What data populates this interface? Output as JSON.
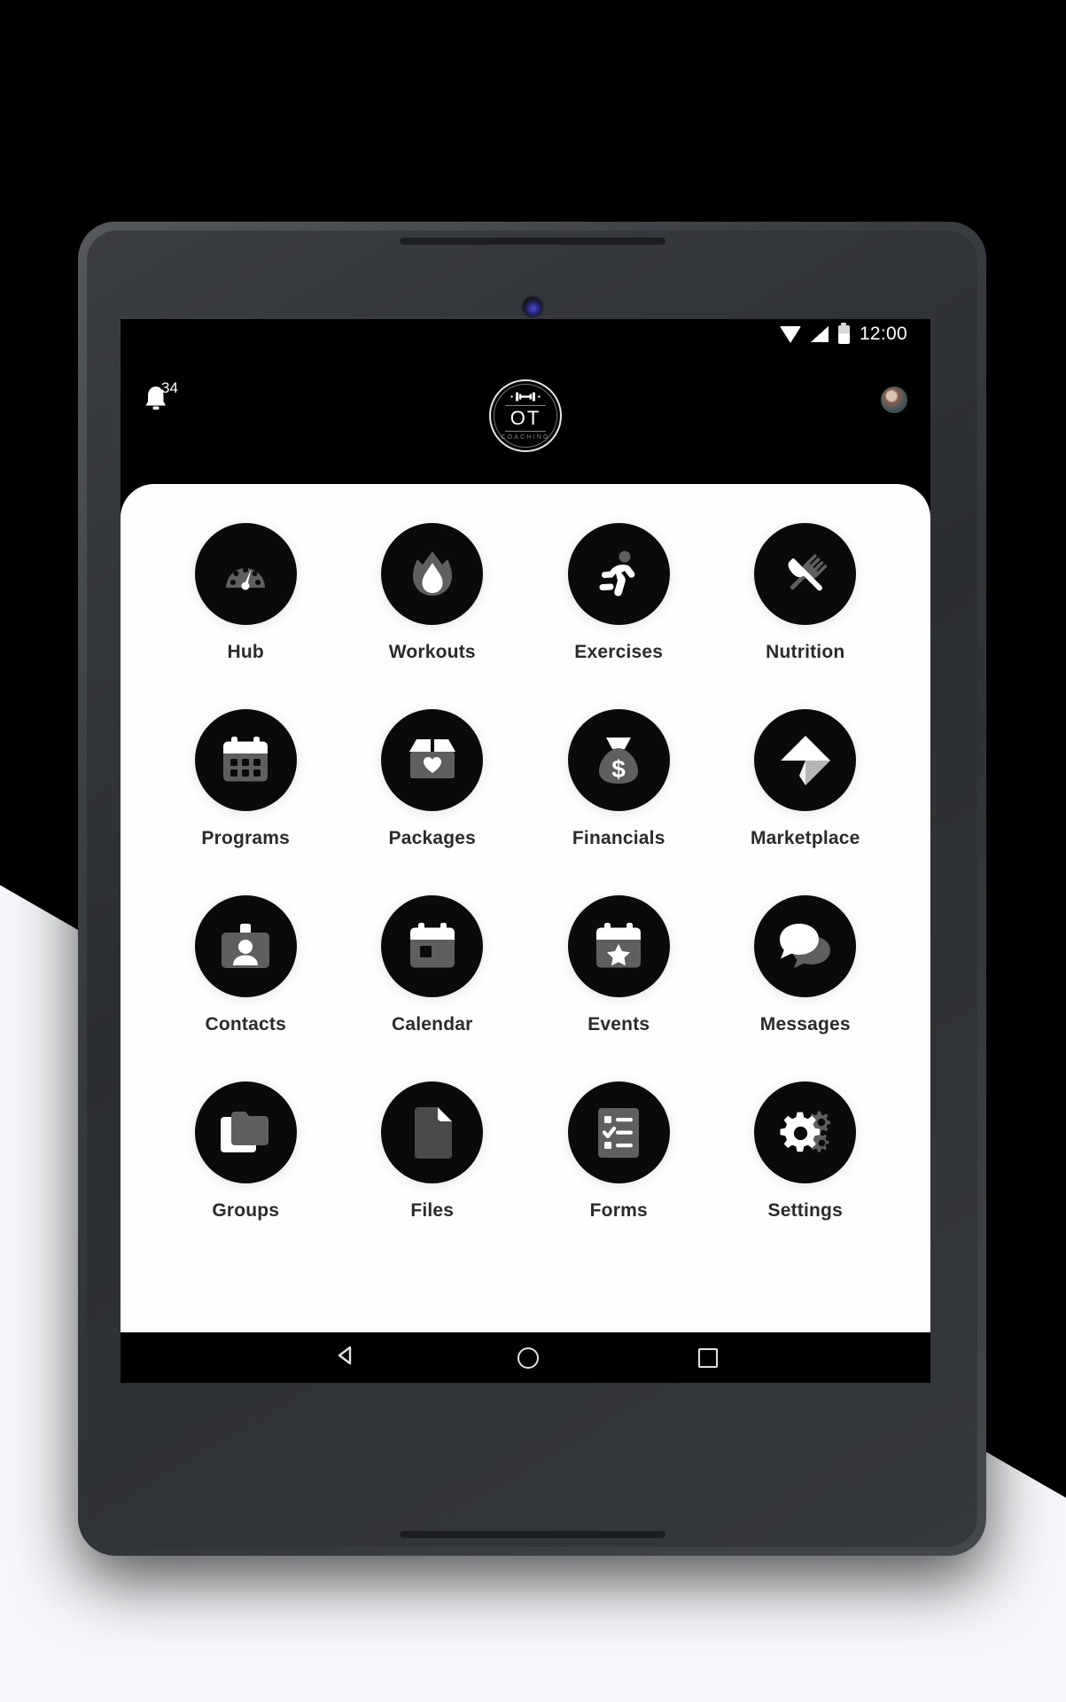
{
  "status_bar": {
    "time": "12:00",
    "icons": [
      "wifi-icon",
      "signal-icon",
      "battery-icon"
    ]
  },
  "app_bar": {
    "notifications_badge": "34",
    "bell_icon": "bell-icon",
    "logo": {
      "title": "OT",
      "subtitle": "COACHING",
      "mark": "dumbbell-icon"
    },
    "avatar": "user-avatar"
  },
  "grid": {
    "items": [
      {
        "label": "Hub",
        "icon": "gauge-icon"
      },
      {
        "label": "Workouts",
        "icon": "flame-icon"
      },
      {
        "label": "Exercises",
        "icon": "running-person-icon"
      },
      {
        "label": "Nutrition",
        "icon": "fork-knife-icon"
      },
      {
        "label": "Programs",
        "icon": "calendar-grid-icon"
      },
      {
        "label": "Packages",
        "icon": "box-heart-icon"
      },
      {
        "label": "Financials",
        "icon": "money-bag-icon"
      },
      {
        "label": "Marketplace",
        "icon": "send-arrow-icon"
      },
      {
        "label": "Contacts",
        "icon": "id-badge-icon"
      },
      {
        "label": "Calendar",
        "icon": "calendar-icon"
      },
      {
        "label": "Events",
        "icon": "calendar-star-icon"
      },
      {
        "label": "Messages",
        "icon": "chat-bubbles-icon"
      },
      {
        "label": "Groups",
        "icon": "folders-icon"
      },
      {
        "label": "Files",
        "icon": "document-icon"
      },
      {
        "label": "Forms",
        "icon": "checklist-icon"
      },
      {
        "label": "Settings",
        "icon": "gears-icon"
      }
    ]
  },
  "nav_bar": {
    "back": "back-triangle-icon",
    "home": "home-circle-icon",
    "recents": "recents-square-icon"
  },
  "colors": {
    "background": "#000000",
    "sheet": "#fefefe",
    "tile_circle": "#0a0a0a",
    "icon_primary": "#ffffff",
    "icon_secondary": "#5f5f5f",
    "label": "#2b2b2b"
  }
}
